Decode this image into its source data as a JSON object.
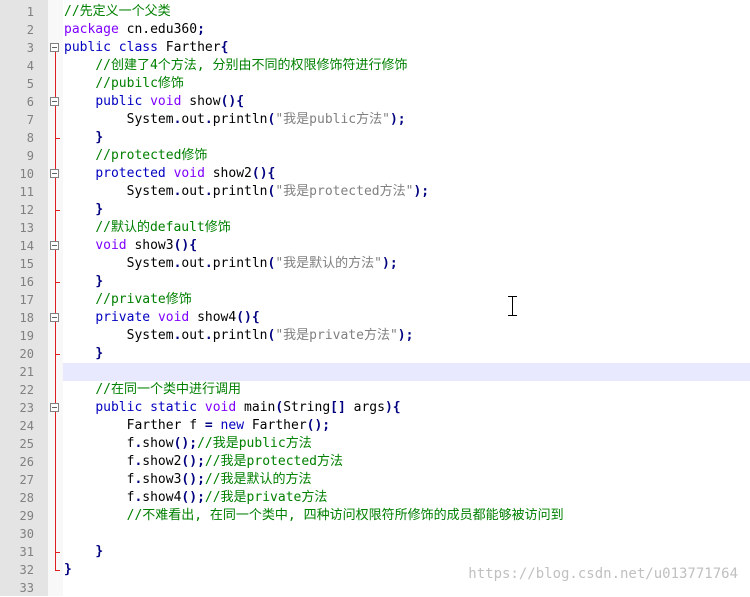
{
  "editor": {
    "line_numbers": [
      "1",
      "2",
      "3",
      "4",
      "5",
      "6",
      "7",
      "8",
      "9",
      "10",
      "11",
      "12",
      "13",
      "14",
      "15",
      "16",
      "17",
      "18",
      "19",
      "20",
      "21",
      "22",
      "23",
      "24",
      "25",
      "26",
      "27",
      "28",
      "29",
      "30",
      "31",
      "32",
      "33"
    ],
    "lines": [
      [
        {
          "t": "//先定义一个父类",
          "c": "cm"
        }
      ],
      [
        {
          "t": "package",
          "c": "k2"
        },
        {
          "t": " cn.edu360"
        },
        {
          "t": ";",
          "c": "op"
        }
      ],
      [
        {
          "t": "public",
          "c": "k1"
        },
        {
          "t": " "
        },
        {
          "t": "class",
          "c": "k1"
        },
        {
          "t": " Farther"
        },
        {
          "t": "{",
          "c": "op"
        }
      ],
      [
        {
          "t": "    "
        },
        {
          "t": "//创建了4个方法, 分别由不同的权限修饰符进行修饰",
          "c": "cm"
        }
      ],
      [
        {
          "t": "    "
        },
        {
          "t": "//pubilc修饰",
          "c": "cm"
        }
      ],
      [
        {
          "t": "    "
        },
        {
          "t": "public",
          "c": "k1"
        },
        {
          "t": " "
        },
        {
          "t": "void",
          "c": "k2"
        },
        {
          "t": " show"
        },
        {
          "t": "(){",
          "c": "op"
        }
      ],
      [
        {
          "t": "        System"
        },
        {
          "t": ".",
          "c": "op"
        },
        {
          "t": "out"
        },
        {
          "t": ".",
          "c": "op"
        },
        {
          "t": "println"
        },
        {
          "t": "(",
          "c": "op"
        },
        {
          "t": "\"我是public方法\"",
          "c": "st"
        },
        {
          "t": ");",
          "c": "op"
        }
      ],
      [
        {
          "t": "    "
        },
        {
          "t": "}",
          "c": "op"
        }
      ],
      [
        {
          "t": "    "
        },
        {
          "t": "//protected修饰",
          "c": "cm"
        }
      ],
      [
        {
          "t": "    "
        },
        {
          "t": "protected",
          "c": "k1"
        },
        {
          "t": " "
        },
        {
          "t": "void",
          "c": "k2"
        },
        {
          "t": " show2"
        },
        {
          "t": "(){",
          "c": "op"
        }
      ],
      [
        {
          "t": "        System"
        },
        {
          "t": ".",
          "c": "op"
        },
        {
          "t": "out"
        },
        {
          "t": ".",
          "c": "op"
        },
        {
          "t": "println"
        },
        {
          "t": "(",
          "c": "op"
        },
        {
          "t": "\"我是protected方法\"",
          "c": "st"
        },
        {
          "t": ");",
          "c": "op"
        }
      ],
      [
        {
          "t": "    "
        },
        {
          "t": "}",
          "c": "op"
        }
      ],
      [
        {
          "t": "    "
        },
        {
          "t": "//默认的default修饰",
          "c": "cm"
        }
      ],
      [
        {
          "t": "    "
        },
        {
          "t": "void",
          "c": "k2"
        },
        {
          "t": " show3"
        },
        {
          "t": "(){",
          "c": "op"
        }
      ],
      [
        {
          "t": "        System"
        },
        {
          "t": ".",
          "c": "op"
        },
        {
          "t": "out"
        },
        {
          "t": ".",
          "c": "op"
        },
        {
          "t": "println"
        },
        {
          "t": "(",
          "c": "op"
        },
        {
          "t": "\"我是默认的方法\"",
          "c": "st"
        },
        {
          "t": ");",
          "c": "op"
        }
      ],
      [
        {
          "t": "    "
        },
        {
          "t": "}",
          "c": "op"
        }
      ],
      [
        {
          "t": "    "
        },
        {
          "t": "//private修饰",
          "c": "cm"
        }
      ],
      [
        {
          "t": "    "
        },
        {
          "t": "private",
          "c": "k1"
        },
        {
          "t": " "
        },
        {
          "t": "void",
          "c": "k2"
        },
        {
          "t": " show4"
        },
        {
          "t": "(){",
          "c": "op"
        }
      ],
      [
        {
          "t": "        System"
        },
        {
          "t": ".",
          "c": "op"
        },
        {
          "t": "out"
        },
        {
          "t": ".",
          "c": "op"
        },
        {
          "t": "println"
        },
        {
          "t": "(",
          "c": "op"
        },
        {
          "t": "\"我是private方法\"",
          "c": "st"
        },
        {
          "t": ");",
          "c": "op"
        }
      ],
      [
        {
          "t": "    "
        },
        {
          "t": "}",
          "c": "op"
        }
      ],
      [],
      [
        {
          "t": "    "
        },
        {
          "t": "//在同一个类中进行调用",
          "c": "cm"
        }
      ],
      [
        {
          "t": "    "
        },
        {
          "t": "public",
          "c": "k1"
        },
        {
          "t": " "
        },
        {
          "t": "static",
          "c": "k1"
        },
        {
          "t": " "
        },
        {
          "t": "void",
          "c": "k2"
        },
        {
          "t": " main"
        },
        {
          "t": "(",
          "c": "op"
        },
        {
          "t": "String"
        },
        {
          "t": "[]",
          "c": "op"
        },
        {
          "t": " args"
        },
        {
          "t": "){",
          "c": "op"
        }
      ],
      [
        {
          "t": "        Farther f "
        },
        {
          "t": "=",
          "c": "op"
        },
        {
          "t": " "
        },
        {
          "t": "new",
          "c": "k1"
        },
        {
          "t": " Farther"
        },
        {
          "t": "();",
          "c": "op"
        }
      ],
      [
        {
          "t": "        f"
        },
        {
          "t": ".",
          "c": "op"
        },
        {
          "t": "show"
        },
        {
          "t": "();",
          "c": "op"
        },
        {
          "t": "//我是public方法",
          "c": "cm"
        }
      ],
      [
        {
          "t": "        f"
        },
        {
          "t": ".",
          "c": "op"
        },
        {
          "t": "show2"
        },
        {
          "t": "();",
          "c": "op"
        },
        {
          "t": "//我是protected方法",
          "c": "cm"
        }
      ],
      [
        {
          "t": "        f"
        },
        {
          "t": ".",
          "c": "op"
        },
        {
          "t": "show3"
        },
        {
          "t": "();",
          "c": "op"
        },
        {
          "t": "//我是默认的方法",
          "c": "cm"
        }
      ],
      [
        {
          "t": "        f"
        },
        {
          "t": ".",
          "c": "op"
        },
        {
          "t": "show4"
        },
        {
          "t": "();",
          "c": "op"
        },
        {
          "t": "//我是private方法",
          "c": "cm"
        }
      ],
      [
        {
          "t": "        "
        },
        {
          "t": "//不难看出, 在同一个类中, 四种访问权限符所修饰的成员都能够被访问到",
          "c": "cm"
        }
      ],
      [],
      [
        {
          "t": "    "
        },
        {
          "t": "}",
          "c": "op"
        }
      ],
      [
        {
          "t": "}",
          "c": "op"
        }
      ],
      []
    ]
  },
  "watermark": "https://blog.csdn.net/u013771764",
  "colors": {
    "keyword_blue": "#0000c0",
    "keyword_purple": "#8000ff",
    "comment_green": "#008000",
    "string_gray": "#808080",
    "operator_navy": "#000080",
    "current_line": "#e8e8ff",
    "gutter": "#e4e4e4",
    "fold_marker": "#e02020"
  }
}
